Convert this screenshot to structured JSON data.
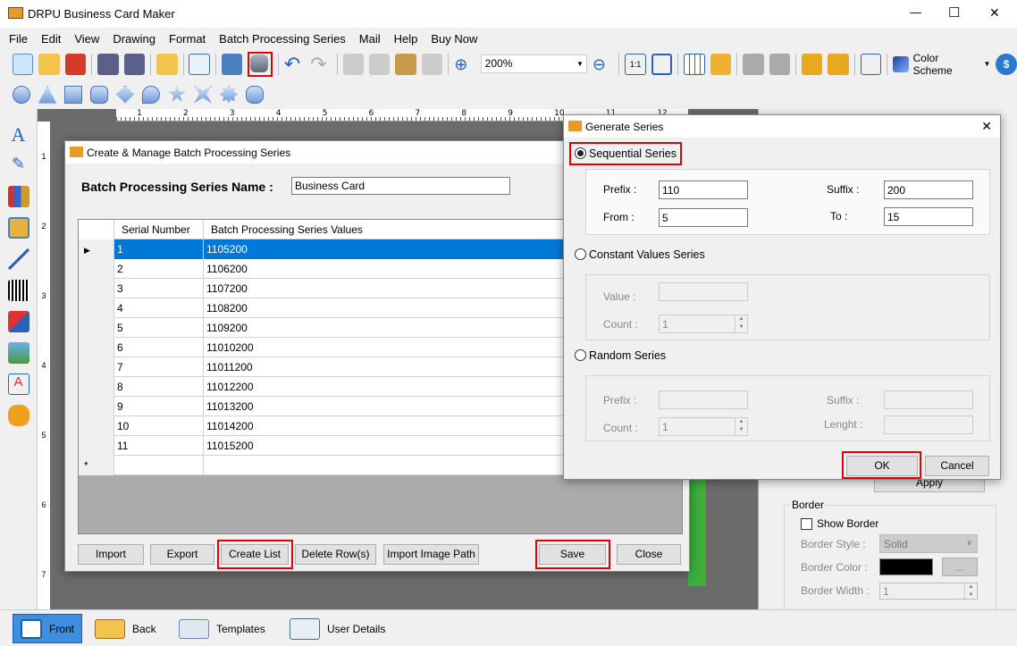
{
  "app": {
    "title": "DRPU Business Card Maker",
    "controls": [
      "—",
      "☐",
      "✕"
    ]
  },
  "menu": [
    "File",
    "Edit",
    "View",
    "Drawing",
    "Format",
    "Batch Processing Series",
    "Mail",
    "Help",
    "Buy Now"
  ],
  "toolbar": {
    "zoom": "200%",
    "color_scheme": "Color Scheme"
  },
  "ruler": [
    "1",
    "2",
    "3",
    "4",
    "5",
    "6",
    "7",
    "8",
    "9",
    "10",
    "11",
    "12"
  ],
  "vruler": [
    "1",
    "2",
    "3",
    "4",
    "5",
    "6",
    "7"
  ],
  "batch": {
    "title": "Create & Manage Batch Processing Series",
    "name_label": "Batch Processing Series Name :",
    "name_value": "Business Card",
    "columns": [
      "Serial Number",
      "Batch Processing Series Values"
    ],
    "rows": [
      [
        "1",
        "1105200"
      ],
      [
        "2",
        "1106200"
      ],
      [
        "3",
        "1107200"
      ],
      [
        "4",
        "1108200"
      ],
      [
        "5",
        "1109200"
      ],
      [
        "6",
        "11010200"
      ],
      [
        "7",
        "11011200"
      ],
      [
        "8",
        "11012200"
      ],
      [
        "9",
        "11013200"
      ],
      [
        "10",
        "11014200"
      ],
      [
        "11",
        "11015200"
      ]
    ],
    "new_row_marker": "*",
    "buttons": {
      "import": "Import",
      "export": "Export",
      "create_list": "Create List",
      "delete": "Delete Row(s)",
      "import_image": "Import Image Path",
      "save": "Save",
      "close": "Close"
    }
  },
  "generate": {
    "title": "Generate Series",
    "sequential": {
      "label": "Sequential Series",
      "selected": true,
      "prefix_label": "Prefix :",
      "prefix": "110",
      "suffix_label": "Suffix :",
      "suffix": "200",
      "from_label": "From :",
      "from": "5",
      "to_label": "To :",
      "to": "15"
    },
    "constant": {
      "label": "Constant Values Series",
      "selected": false,
      "value_label": "Value :",
      "value": "",
      "count_label": "Count :",
      "count": "1"
    },
    "random": {
      "label": "Random Series",
      "selected": false,
      "prefix_label": "Prefix :",
      "prefix": "",
      "suffix_label": "Suffix :",
      "suffix": "",
      "count_label": "Count :",
      "count": "1",
      "length_label": "Lenght :",
      "length": ""
    },
    "ok": "OK",
    "cancel": "Cancel"
  },
  "right_panel": {
    "apply": "Apply",
    "border_title": "Border",
    "show_border": "Show Border",
    "show_border_checked": false,
    "style_label": "Border Style :",
    "style": "Solid",
    "color_label": "Border Color :",
    "color": "#000000",
    "more": "...",
    "width_label": "Border Width :",
    "width": "1"
  },
  "bottom_tabs": [
    {
      "label": "Front",
      "active": true
    },
    {
      "label": "Back"
    },
    {
      "label": "Templates"
    },
    {
      "label": "User Details"
    }
  ]
}
